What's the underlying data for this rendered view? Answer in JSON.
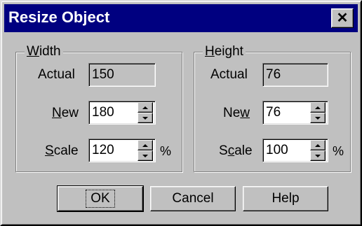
{
  "window": {
    "title": "Resize Object",
    "close_glyph": "✕"
  },
  "width_group": {
    "legend_u": "W",
    "legend_rest": "idth",
    "actual_label": "Actual",
    "actual_value": "150",
    "new_label_u": "N",
    "new_label_rest": "ew",
    "new_value": "180",
    "scale_label_u": "S",
    "scale_label_rest": "cale",
    "scale_value": "120",
    "percent": "%"
  },
  "height_group": {
    "legend_u": "H",
    "legend_rest": "eight",
    "actual_label": "Actual",
    "actual_value": "76",
    "new_label_pre": "Ne",
    "new_label_u": "w",
    "new_value": "76",
    "scale_label_pre": "S",
    "scale_label_u": "c",
    "scale_label_rest": "ale",
    "scale_value": "100",
    "percent": "%"
  },
  "buttons": {
    "ok": "OK",
    "cancel": "Cancel",
    "help": "Help"
  }
}
